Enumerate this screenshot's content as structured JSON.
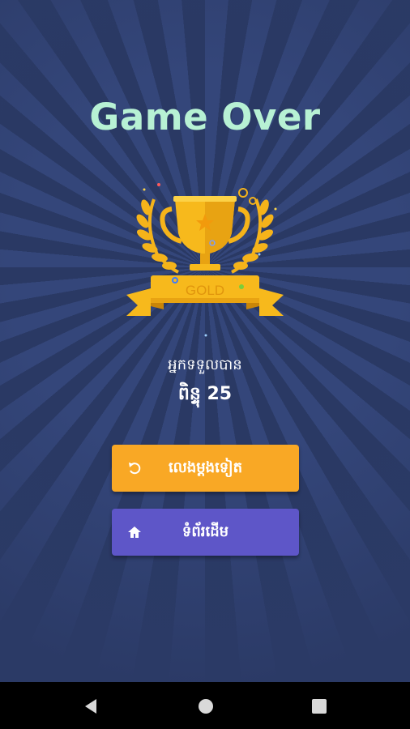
{
  "game": {
    "title": "Game Over",
    "badge_text": "GOLD",
    "result_label": "អ្នកទទួលបាន",
    "score_text": "ពិន្ទុ 25"
  },
  "buttons": {
    "replay": {
      "label": "លេងម្តងទៀត",
      "icon": "replay-icon"
    },
    "home": {
      "label": "ទំព័រដើម",
      "icon": "home-icon"
    }
  },
  "navbar": {
    "items": [
      "back-icon",
      "home-circle-icon",
      "recent-apps-icon"
    ]
  },
  "colors": {
    "background": "#2b3a66",
    "title": "#b7f1d4",
    "replay_button": "#f9a825",
    "home_button": "#5e56c8",
    "trophy_gold": "#f7b91c"
  }
}
